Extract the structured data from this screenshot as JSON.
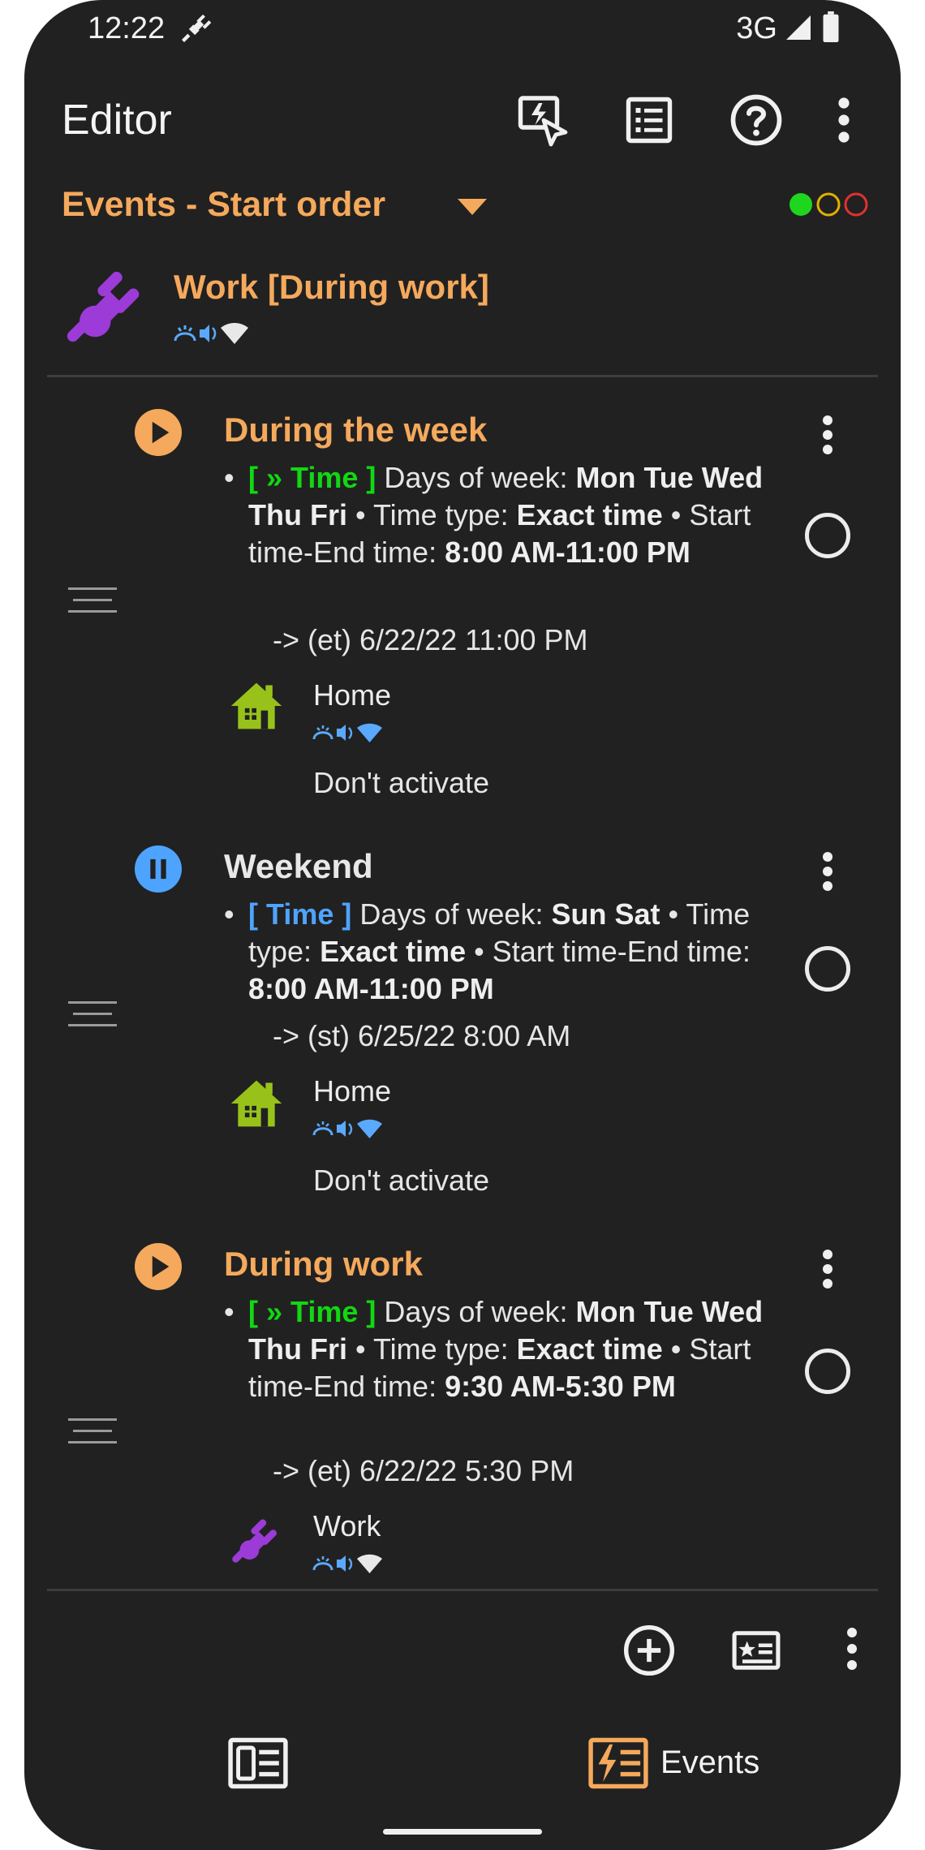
{
  "status_bar": {
    "time": "12:22",
    "network": "3G",
    "icons": [
      "plug-icon",
      "signal-icon",
      "battery-icon"
    ]
  },
  "toolbar": {
    "title": "Editor",
    "actions": [
      "run-app-icon",
      "list-icon",
      "help-icon",
      "more-vert-icon"
    ]
  },
  "header": {
    "filter_label": "Events - Start order",
    "indicator_colors": [
      "#1ed61e",
      "#e0b000",
      "#e23030"
    ]
  },
  "profile": {
    "name": "Work [During work]",
    "icon": "plug-icon",
    "mini_icons": [
      "vibrate-icon",
      "volume-icon",
      "wifi-icon"
    ]
  },
  "events": [
    {
      "name": "During the week",
      "status": "running",
      "name_color": "#f5a95c",
      "status_color": "#f5a95c",
      "tag": "[ » Time ]",
      "tag_type": "green",
      "cond_days_label": " Days of week: ",
      "cond_days": "Mon Tue Wed Thu Fri",
      "cond_type_label": " • Time type: ",
      "cond_type": "Exact time",
      "cond_range_label": " • Start time-End time: ",
      "cond_range": "8:00 AM-11:00 PM",
      "next": "-> (et) 6/22/22 11:00 PM",
      "profile_name": "Home",
      "profile_icon": "house-icon",
      "note": "Don't activate"
    },
    {
      "name": "Weekend",
      "status": "paused",
      "name_color": "#e8e8e8",
      "status_color": "#4ea3ff",
      "tag": "[ Time ]",
      "tag_type": "blue",
      "cond_days_label": " Days of week: ",
      "cond_days": "Sun Sat",
      "cond_type_label": " • Time type: ",
      "cond_type": "Exact time",
      "cond_range_label": " • Start time-End time: ",
      "cond_range": "8:00 AM-11:00 PM",
      "next": "-> (st) 6/25/22 8:00 AM",
      "profile_name": "Home",
      "profile_icon": "house-icon",
      "note": "Don't activate"
    },
    {
      "name": "During work",
      "status": "running",
      "name_color": "#f5a95c",
      "status_color": "#f5a95c",
      "tag": "[ » Time ]",
      "tag_type": "green",
      "cond_days_label": " Days of week: ",
      "cond_days": "Mon Tue Wed Thu Fri",
      "cond_type_label": " • Time type: ",
      "cond_type": "Exact time",
      "cond_range_label": " • Start time-End time: ",
      "cond_range": "9:30 AM-5:30 PM",
      "next": "-> (et) 6/22/22 5:30 PM",
      "profile_name": "Work",
      "profile_icon": "plug-icon"
    }
  ],
  "bottom_actions": [
    "add-circle-icon",
    "preferences-card-icon",
    "more-vert-icon"
  ],
  "bottom_nav": {
    "events_label": "Events",
    "profiles_icon": "profiles-icon",
    "events_icon": "events-icon"
  },
  "accent": "#f5a95c"
}
